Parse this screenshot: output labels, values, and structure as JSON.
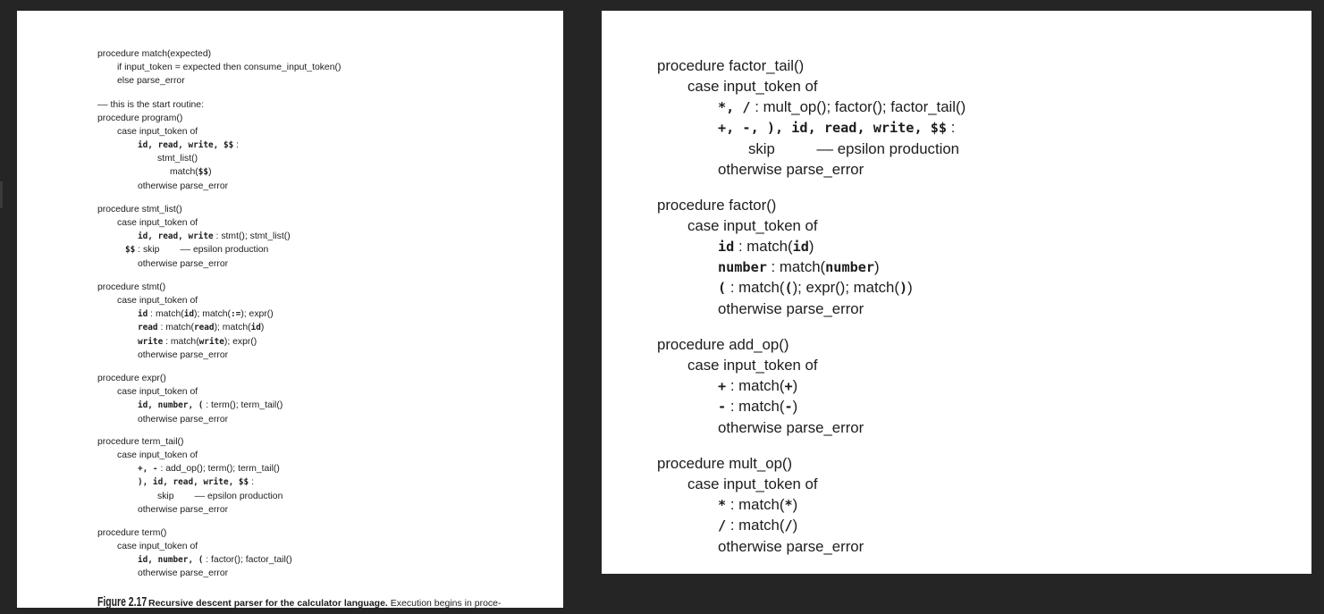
{
  "left_page": {
    "lines": [
      [
        "procedure match(expected)"
      ],
      [
        "if input_token = expected then consume_input_token()"
      ],
      [
        "else parse_error"
      ],
      [
        "–– this is the start routine:"
      ],
      [
        "procedure program()"
      ],
      [
        "case input_token of"
      ],
      [
        "id, read, write, $$",
        " :"
      ],
      [
        "stmt_list()"
      ],
      [
        "match(",
        "$$",
        ")"
      ],
      [
        "otherwise parse_error"
      ],
      [
        "procedure stmt_list()"
      ],
      [
        "case input_token of"
      ],
      [
        "id, read, write",
        " : stmt(); stmt_list()"
      ],
      [
        "$$",
        " : skip        –– epsilon production"
      ],
      [
        "otherwise parse_error"
      ],
      [
        "procedure stmt()"
      ],
      [
        "case input_token of"
      ],
      [
        "id",
        " : match(",
        "id",
        "); match(",
        ":=",
        "); expr()"
      ],
      [
        "read",
        " : match(",
        "read",
        "); match(",
        "id",
        ")"
      ],
      [
        "write",
        " : match(",
        "write",
        "); expr()"
      ],
      [
        "otherwise parse_error"
      ],
      [
        "procedure expr()"
      ],
      [
        "case input_token of"
      ],
      [
        "id, number, (",
        " : term(); term_tail()"
      ],
      [
        "otherwise parse_error"
      ],
      [
        "procedure term_tail()"
      ],
      [
        "case input_token of"
      ],
      [
        "+, -",
        " : add_op(); term(); term_tail()"
      ],
      [
        "), id, read, write, $$",
        " :"
      ],
      [
        "skip        –– epsilon production"
      ],
      [
        "otherwise parse_error"
      ],
      [
        "procedure term()"
      ],
      [
        "case input_token of"
      ],
      [
        "id, number, (",
        " : factor(); factor_tail()"
      ],
      [
        "otherwise parse_error"
      ]
    ],
    "caption": {
      "number": "Figure 2.17",
      "title": "Recursive descent parser for the calculator language.",
      "text": " Execution begins in proce-"
    }
  },
  "right_page": {
    "lines": [
      [
        "procedure factor_tail()"
      ],
      [
        "case input_token of"
      ],
      [
        "*, /",
        " : mult_op(); factor(); factor_tail()"
      ],
      [
        "+, -, ), id, read, write, $$",
        " :"
      ],
      [
        "skip          –– epsilon production"
      ],
      [
        "otherwise parse_error"
      ],
      [
        "procedure factor()"
      ],
      [
        "case input_token of"
      ],
      [
        "id",
        " : match(",
        "id",
        ")"
      ],
      [
        "number",
        " : match(",
        "number",
        ")"
      ],
      [
        "(",
        " : match(",
        "(",
        "); expr(); match(",
        ")",
        ")"
      ],
      [
        "otherwise parse_error"
      ],
      [
        "procedure add_op()"
      ],
      [
        "case input_token of"
      ],
      [
        "+",
        " : match(",
        "+",
        ")"
      ],
      [
        "-",
        " : match(",
        "-",
        ")"
      ],
      [
        "otherwise parse_error"
      ],
      [
        "procedure mult_op()"
      ],
      [
        "case input_token of"
      ],
      [
        "*",
        " : match(",
        "*",
        ")"
      ],
      [
        "/",
        " : match(",
        "/",
        ")"
      ],
      [
        "otherwise parse_error"
      ]
    ]
  }
}
